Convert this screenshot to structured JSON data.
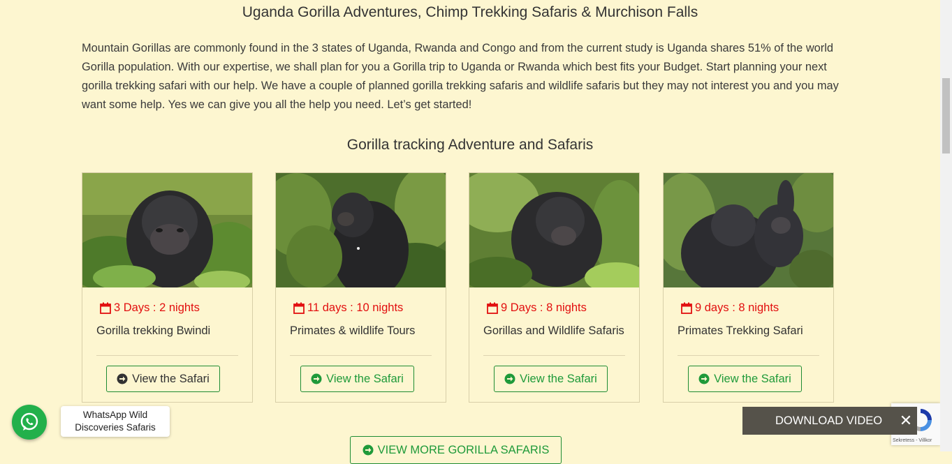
{
  "heading": "Uganda Gorilla Adventures, Chimp Trekking Safaris & Murchison Falls",
  "intro": "Mountain Gorillas are commonly found in the 3 states of Uganda, Rwanda and Congo and from the current study is Uganda shares 51% of the world Gorilla population. With our expertise, we shall plan for you a Gorilla trip to Uganda or Rwanda which best fits your Budget. Start planning your next gorilla trekking safari with our help. We have a couple of planned gorilla trekking safaris and wildlife safaris but they may not interest you and you may want some help. Yes we can give you all the help you need. Let’s get started!",
  "subheading": "Gorilla tracking Adventure and Safaris",
  "cards": [
    {
      "duration": "3 Days : 2 nights",
      "title": "Gorilla trekking Bwindi",
      "button": "View the Safari"
    },
    {
      "duration": "11 days : 10 nights",
      "title": "Primates & wildlife Tours",
      "button": "View the Safari"
    },
    {
      "duration": "9 Days : 8 nights",
      "title": "Gorillas and Wildlife Safaris",
      "button": "View the Safari"
    },
    {
      "duration": "9 days : 8 nights",
      "title": "Primates Trekking Safari",
      "button": "View the Safari"
    }
  ],
  "more_button": "VIEW MORE GORILLA SAFARIS",
  "whatsapp": {
    "line1": "WhatsApp Wild",
    "line2": "Discoveries Safaris"
  },
  "download_bar": {
    "label": "DOWNLOAD VIDEO",
    "close": "✕"
  },
  "recaptcha": {
    "links": "Sekretess - Villkor"
  },
  "colors": {
    "background": "#fdf6d0",
    "accent_green": "#1f9a3a",
    "duration_red": "#e20f0f",
    "whatsapp_green": "#22b04b"
  },
  "icons": [
    "calendar-icon",
    "arrow-circle-right-icon",
    "whatsapp-icon",
    "close-icon",
    "recaptcha-logo-icon"
  ]
}
